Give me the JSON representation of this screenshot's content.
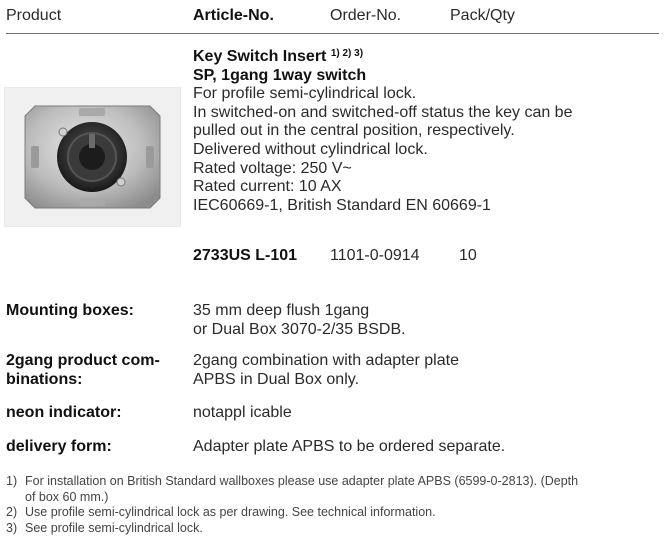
{
  "header": {
    "col_product": "Product",
    "col_article": "Article-No.",
    "col_order": "Order-No.",
    "col_pack": "Pack/Qty"
  },
  "product": {
    "title": "Key Switch Insert",
    "title_refs": "1) 2) 3)",
    "subtitle": "SP, 1gang 1way switch",
    "lines": [
      "For profile semi-cylindrical lock.",
      "In switched-on and switched-off status the key can be",
      "pulled out in the central position, respectively.",
      "Delivered without cylindrical lock.",
      "Rated voltage: 250 V~",
      "Rated current: 10 AX",
      "IEC60669-1, British Standard EN 60669-1"
    ],
    "article_no": "2733US L-101",
    "order_no": "1101-0-0914",
    "pack_qty": "10"
  },
  "specs": {
    "mounting_label": "Mounting boxes:",
    "mounting_value": [
      "35 mm deep flush 1gang",
      "or Dual Box 3070-2/35 BSDB."
    ],
    "combo_label": [
      "2gang product com-",
      "binations:"
    ],
    "combo_value": [
      "2gang combination with adapter plate",
      "APBS in Dual Box only."
    ],
    "neon_label": "neon indicator:",
    "neon_value": "notappl icable",
    "delivery_label": "delivery form:",
    "delivery_value": "Adapter plate APBS to be ordered separate."
  },
  "footnotes": [
    {
      "num": "1)",
      "lines": [
        "For installation on British Standard wallboxes please use adapter plate APBS (6599-0-2813). (Depth",
        "of box 60 mm.)"
      ]
    },
    {
      "num": "2)",
      "lines": [
        "Use profile semi-cylindrical lock as per drawing. See technical information."
      ]
    },
    {
      "num": "3)",
      "lines": [
        "See profile semi-cylindrical lock."
      ]
    }
  ]
}
